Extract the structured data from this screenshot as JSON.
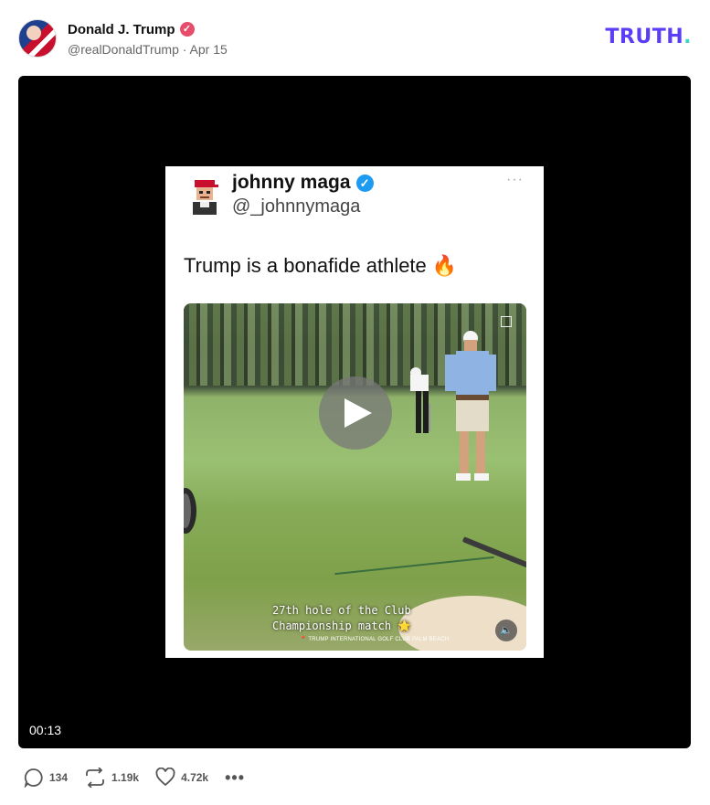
{
  "post": {
    "author_name": "Donald J. Trump",
    "handle": "@realDonaldTrump",
    "separator": "·",
    "date": "Apr 15",
    "verified_icon": "verified-badge-icon",
    "accent_color": "#e84c6b"
  },
  "brand": {
    "logo_text": "TRUTH",
    "logo_dot": ".",
    "logo_color": "#5b3df5",
    "dot_color": "#3dd6c4"
  },
  "video": {
    "timestamp": "00:13"
  },
  "embedded_card": {
    "name": "johnny maga",
    "handle": "@_johnnymaga",
    "text": "Trump is a bonafide athlete 🔥",
    "more": "···",
    "caption_lines": "27th hole of the Club\nChampionship match 🌟",
    "location": "📍 TRUMP INTERNATIONAL GOLF CLUB PALM BEACH",
    "verified_color": "#1d9bf0"
  },
  "actions": {
    "replies": "134",
    "retruths": "1.19k",
    "likes": "4.72k",
    "more": "•••"
  }
}
